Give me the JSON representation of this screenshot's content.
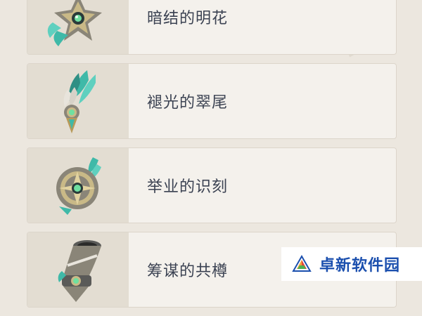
{
  "artifacts": [
    {
      "name": "暗结的明花",
      "icon": "artifact-flower-icon"
    },
    {
      "name": "褪光的翠尾",
      "icon": "artifact-feather-icon"
    },
    {
      "name": "举业的识刻",
      "icon": "artifact-sands-icon"
    },
    {
      "name": "筹谋的共樽",
      "icon": "artifact-goblet-icon"
    }
  ],
  "watermark": {
    "text": "卓新软件园",
    "icon": "site-logo-icon"
  },
  "colors": {
    "background": "#ece7df",
    "card": "#f4f1ec",
    "thumb": "#e3ddd2",
    "text": "#3b4252",
    "teal": "#3fb9a8",
    "gold": "#b89a5a",
    "watermark_text": "#1b4fae"
  }
}
